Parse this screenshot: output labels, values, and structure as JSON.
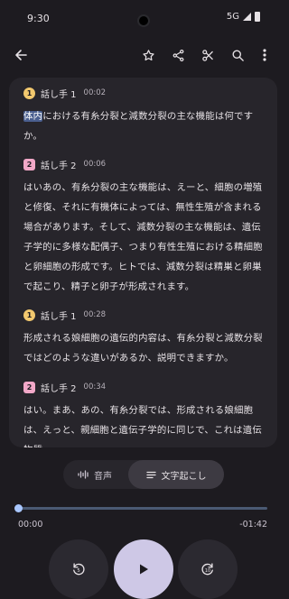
{
  "status": {
    "time": "9:30",
    "network": "5G"
  },
  "toolbar": {
    "icons": [
      "back-arrow-icon",
      "star-icon",
      "share-icon",
      "scissors-icon",
      "search-icon",
      "more-vert-icon"
    ]
  },
  "transcript": {
    "entries": [
      {
        "badge": "1",
        "speaker": "話し手 1",
        "time": "00:02",
        "highlight": "体内",
        "text": "における有糸分裂と減数分裂の主な機能は何ですか。"
      },
      {
        "badge": "2",
        "speaker": "話し手 2",
        "time": "00:06",
        "highlight": "",
        "text": "はいあの、有糸分裂の主な機能は、えーと、細胞の増殖と修復、それに有機体によっては、無性生殖が含まれる場合があります。そして、減数分裂の主な機能は、遺伝子学的に多様な配偶子、つまり有性生殖における精細胞と卵細胞の形成です。ヒトでは、減数分裂は精巣と卵巣で起こり、精子と卵子が形成されます。"
      },
      {
        "badge": "1",
        "speaker": "話し手 1",
        "time": "00:28",
        "highlight": "",
        "text": "形成される娘細胞の遺伝的内容は、有糸分裂と減数分裂ではどのような違いがあるか、説明できますか。"
      },
      {
        "badge": "2",
        "speaker": "話し手 2",
        "time": "00:34",
        "highlight": "",
        "text": "はい。まあ、あの、有糸分裂では、形成される娘細胞は、えっと、親細胞と遺伝子学的に同じで、これは遺伝物質"
      }
    ]
  },
  "tabs": {
    "audio_label": "音声",
    "transcript_label": "文字起こし",
    "selected": "transcript"
  },
  "player": {
    "current_time": "00:00",
    "remaining_time": "-01:42",
    "progress": 0.0,
    "rewind_icon": "replay-5-icon",
    "play_icon": "play-icon",
    "forward_icon": "forward-10-icon"
  },
  "colors": {
    "background": "#1d1b20",
    "card": "#27252b",
    "accent": "#a9c7ff",
    "play_button": "#cec8e6",
    "speaker1": "#f2c86e",
    "speaker2": "#f2a8c8"
  }
}
